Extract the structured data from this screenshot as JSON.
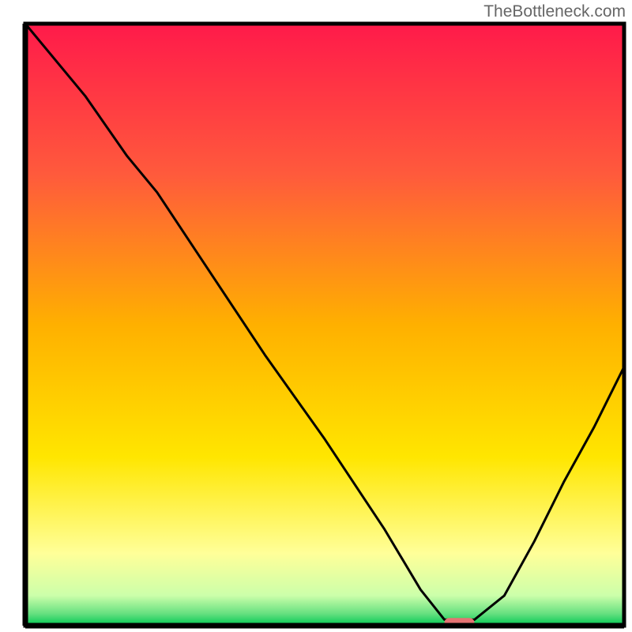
{
  "watermark": "TheBottleneck.com",
  "chart_data": {
    "type": "line",
    "title": "",
    "xlabel": "",
    "ylabel": "",
    "description": "Bottleneck curve on a vertical gradient background. Black curve starts from the top-left corner, dips to a minimum near x≈0.72 where a small red/pink marker sits, then rises toward the right. A narrow green band runs along the very bottom of the gradient.",
    "x": [
      0.0,
      0.1,
      0.17,
      0.22,
      0.3,
      0.4,
      0.5,
      0.6,
      0.66,
      0.7,
      0.75,
      0.8,
      0.85,
      0.9,
      0.95,
      1.0
    ],
    "values": [
      1.0,
      0.88,
      0.78,
      0.72,
      0.6,
      0.45,
      0.31,
      0.16,
      0.06,
      0.01,
      0.01,
      0.05,
      0.14,
      0.24,
      0.33,
      0.43
    ],
    "xlim": [
      0,
      1
    ],
    "ylim": [
      0,
      1
    ],
    "marker": {
      "x": 0.725,
      "y": 0.005,
      "color": "#e57373"
    },
    "gradient_stops": [
      {
        "pos": 0.0,
        "color": "#ff1a4a"
      },
      {
        "pos": 0.25,
        "color": "#ff5a3c"
      },
      {
        "pos": 0.5,
        "color": "#ffb000"
      },
      {
        "pos": 0.72,
        "color": "#ffe600"
      },
      {
        "pos": 0.88,
        "color": "#ffff99"
      },
      {
        "pos": 0.95,
        "color": "#ccffaa"
      },
      {
        "pos": 0.98,
        "color": "#66e080"
      },
      {
        "pos": 1.0,
        "color": "#00c853"
      }
    ]
  }
}
